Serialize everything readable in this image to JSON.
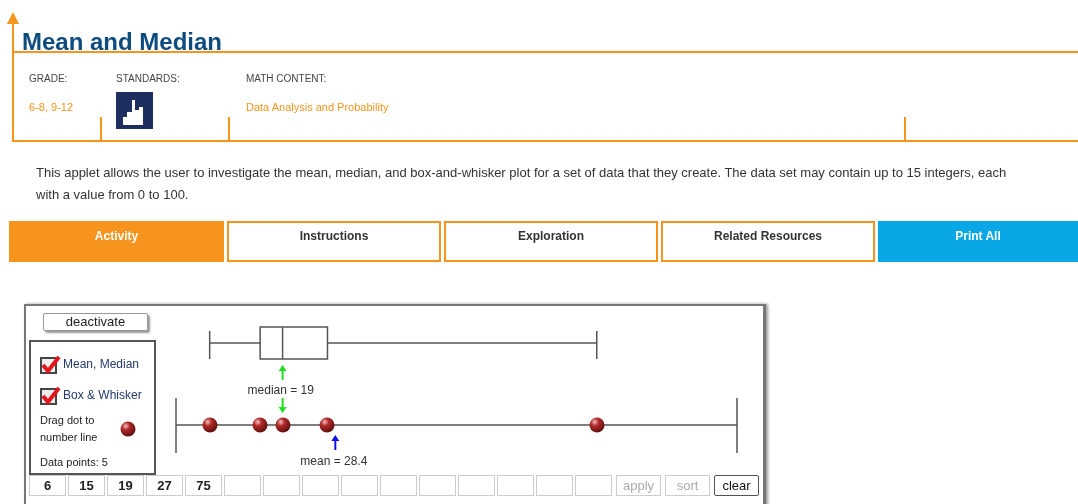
{
  "title": "Mean and Median",
  "info": [
    {
      "label": "GRADE:",
      "value": "6-8, 9-12",
      "kind": "text"
    },
    {
      "label": "STANDARDS:",
      "kind": "icon"
    },
    {
      "label": "MATH CONTENT:",
      "value": "Data Analysis and Probability",
      "kind": "text"
    }
  ],
  "description": "This applet allows the user to investigate the mean, median, and box-and-whisker plot for a set of data that they create. The data set may contain up to 15 integers, each with a value from 0 to 100.",
  "tabs": [
    {
      "label": "Activity",
      "kind": "tab",
      "selected": true
    },
    {
      "label": "Instructions",
      "kind": "tab",
      "selected": false
    },
    {
      "label": "Exploration",
      "kind": "tab",
      "selected": false
    },
    {
      "label": "Related Resources",
      "kind": "tab",
      "selected": false
    },
    {
      "label": "Print All",
      "kind": "action"
    }
  ],
  "applet": {
    "deactivate_button": "deactivate",
    "options": [
      {
        "label": "Mean, Median",
        "checked": true
      },
      {
        "label": "Box & Whisker",
        "checked": true
      }
    ],
    "drag_hint": "Drag dot to number line",
    "data_points_label": "Data points:",
    "data_points": "5",
    "median_label": "median = 19",
    "mean_label": "mean = 28.4",
    "values": [
      "6",
      "15",
      "19",
      "27",
      "75"
    ],
    "buttons": [
      {
        "label": "apply",
        "disabled": true
      },
      {
        "label": "sort",
        "disabled": true
      },
      {
        "label": "clear",
        "disabled": false
      }
    ]
  }
}
